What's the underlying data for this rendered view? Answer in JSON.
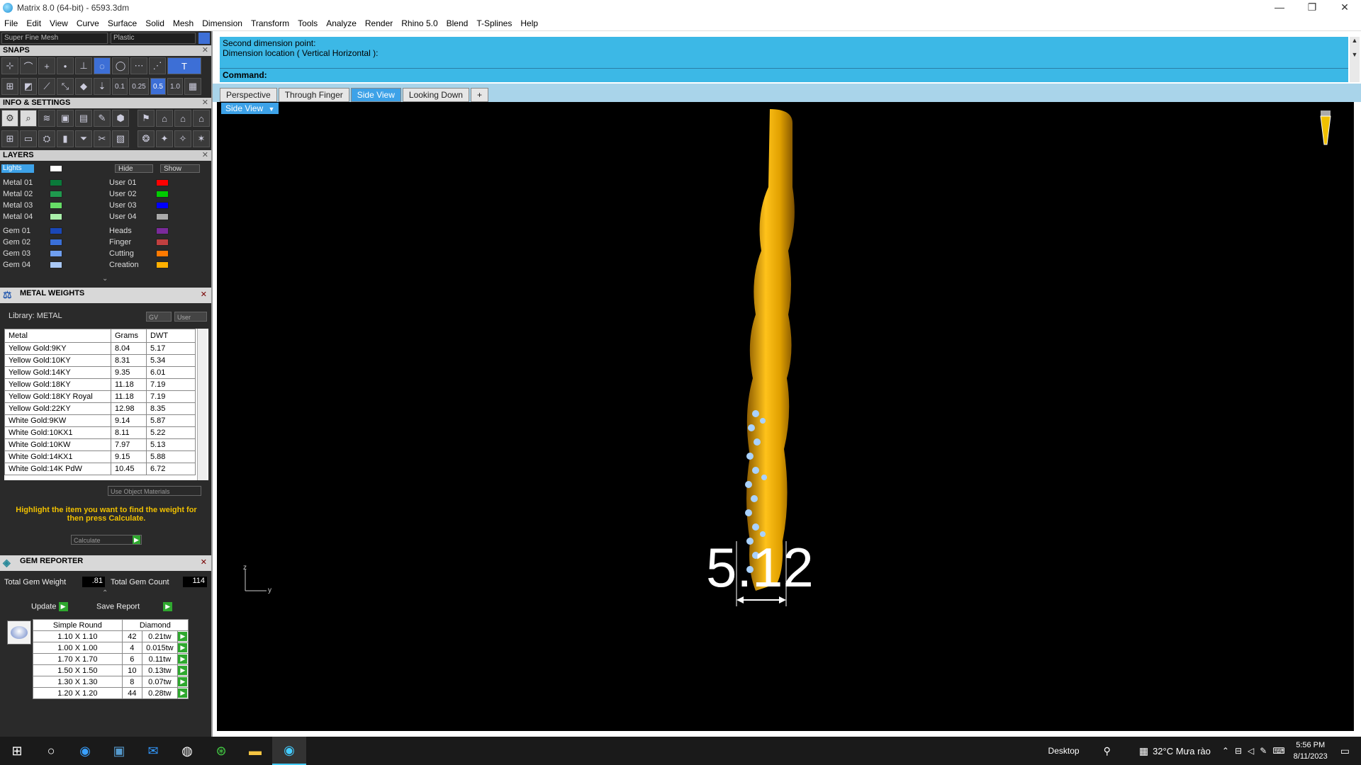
{
  "window": {
    "title": "Matrix 8.0 (64-bit) - 6593.3dm",
    "minimize": "—",
    "maximize": "❐",
    "close": "✕"
  },
  "menu": [
    "File",
    "Edit",
    "View",
    "Curve",
    "Surface",
    "Solid",
    "Mesh",
    "Dimension",
    "Transform",
    "Tools",
    "Analyze",
    "Render",
    "Rhino 5.0",
    "Blend",
    "T-Splines",
    "Help"
  ],
  "left": {
    "mesh_combo": "Super Fine Mesh",
    "material_combo": "Plastic",
    "snaps_title": "SNAPS",
    "snap_values": [
      "0.1",
      "0.25",
      "0.5",
      "1.0"
    ],
    "info_title": "INFO & SETTINGS",
    "layers_title": "LAYERS",
    "lights_label": "Lights",
    "hide_label": "Hide",
    "show_label": "Show",
    "layers_left": [
      "Metal 01",
      "Metal 02",
      "Metal 03",
      "Metal 04",
      "Gem 01",
      "Gem 02",
      "Gem 03",
      "Gem 04"
    ],
    "layers_right": [
      "User 01",
      "User 02",
      "User 03",
      "User 04",
      "Heads",
      "Finger",
      "Cutting",
      "Creation"
    ],
    "colors_left": [
      "#0a7a3a",
      "#1f9a4e",
      "#66dd66",
      "#aaf0aa",
      "#1a47b8",
      "#3a70d8",
      "#6f9ff0",
      "#a9c8f5"
    ],
    "colors_right": [
      "#ff0000",
      "#00cc00",
      "#0000ff",
      "#aaaaaa",
      "#7a2a9a",
      "#c04040",
      "#ff7a00",
      "#ffb000"
    ]
  },
  "metal_weights": {
    "title": "METAL WEIGHTS",
    "library": "Library: METAL",
    "gv": "GV",
    "user": "User",
    "headers": [
      "Metal",
      "Grams",
      "DWT"
    ],
    "rows": [
      [
        "Yellow Gold:9KY",
        "8.04",
        "5.17"
      ],
      [
        "Yellow Gold:10KY",
        "8.31",
        "5.34"
      ],
      [
        "Yellow Gold:14KY",
        "9.35",
        "6.01"
      ],
      [
        "Yellow Gold:18KY",
        "11.18",
        "7.19"
      ],
      [
        "Yellow Gold:18KY Royal",
        "11.18",
        "7.19"
      ],
      [
        "Yellow Gold:22KY",
        "12.98",
        "8.35"
      ],
      [
        "White Gold:9KW",
        "9.14",
        "5.87"
      ],
      [
        "White Gold:10KX1",
        "8.11",
        "5.22"
      ],
      [
        "White Gold:10KW",
        "7.97",
        "5.13"
      ],
      [
        "White Gold:14KX1",
        "9.15",
        "5.88"
      ],
      [
        "White Gold:14K PdW",
        "10.45",
        "6.72"
      ]
    ],
    "use_object_materials": "Use Object Materials",
    "hint": "Highlight the item you want to find the weight for then press Calculate.",
    "calculate": "Calculate"
  },
  "gem_reporter": {
    "title": "GEM REPORTER",
    "total_weight_label": "Total Gem Weight",
    "total_weight": ".81",
    "total_count_label": "Total Gem Count",
    "total_count": "114",
    "update": "Update",
    "save_report": "Save Report",
    "headers": [
      "Simple Round",
      "Diamond"
    ],
    "rows": [
      [
        "1.10 X 1.10",
        "42",
        "0.21tw"
      ],
      [
        "1.00 X 1.00",
        "4",
        "0.015tw"
      ],
      [
        "1.70 X 1.70",
        "6",
        "0.11tw"
      ],
      [
        "1.50 X 1.50",
        "10",
        "0.13tw"
      ],
      [
        "1.30 X 1.30",
        "8",
        "0.07tw"
      ],
      [
        "1.20 X 1.20",
        "44",
        "0.28tw"
      ]
    ]
  },
  "command": {
    "line1": "Second dimension point:",
    "line2": "Dimension location ( Vertical  Horizontal ):",
    "prompt": "Command:"
  },
  "tabs": [
    "Perspective",
    "Through Finger",
    "Side View",
    "Looking Down",
    "+"
  ],
  "viewport": {
    "label": "Side View",
    "dimension": "5.12",
    "axis_z": "z",
    "axis_y": "y"
  },
  "taskbar": {
    "desktop": "Desktop",
    "weather": "32°C  Mưa rào",
    "time": "5:56 PM",
    "date": "8/11/2023"
  }
}
